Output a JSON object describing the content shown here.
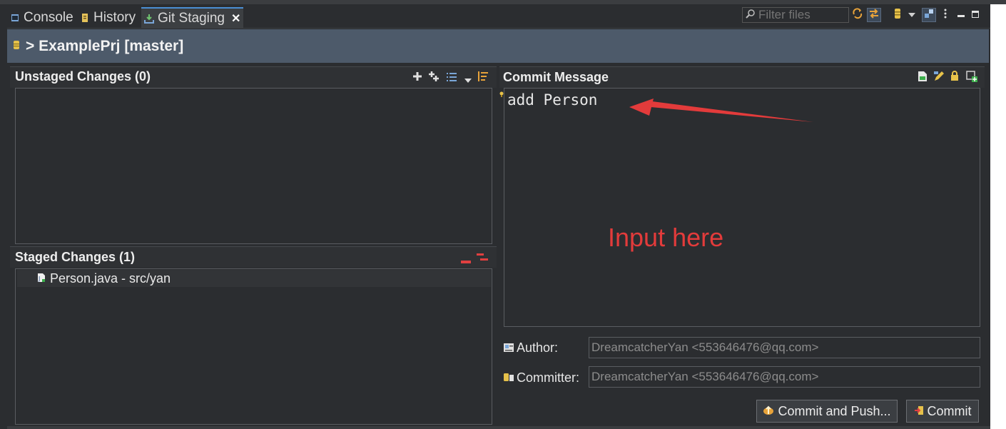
{
  "tabs": [
    {
      "label": "Console",
      "icon": "console-icon"
    },
    {
      "label": "History",
      "icon": "history-icon"
    },
    {
      "label": "Git Staging",
      "icon": "git-staging-icon",
      "active": true
    }
  ],
  "toolbar": {
    "filter_placeholder": "Filter files"
  },
  "repo": {
    "title": "> ExamplePrj [master]"
  },
  "unstaged": {
    "title": "Unstaged Changes (0)"
  },
  "staged": {
    "title": "Staged Changes (1)",
    "files": [
      {
        "label": "Person.java - src/yan"
      }
    ]
  },
  "commit": {
    "title": "Commit Message",
    "message": "add Person",
    "annotation": "Input here",
    "author_label": "Author:",
    "author_value": "DreamcatcherYan <553646476@qq.com>",
    "committer_label": "Committer:",
    "committer_value": "DreamcatcherYan <553646476@qq.com>",
    "commit_push_label": "Commit and Push...",
    "commit_label": "Commit"
  },
  "colors": {
    "accent": "#4a8fd4",
    "annotation": "#e33b3b",
    "header_bg": "#4d5a6a",
    "remove_red": "#e04040"
  }
}
